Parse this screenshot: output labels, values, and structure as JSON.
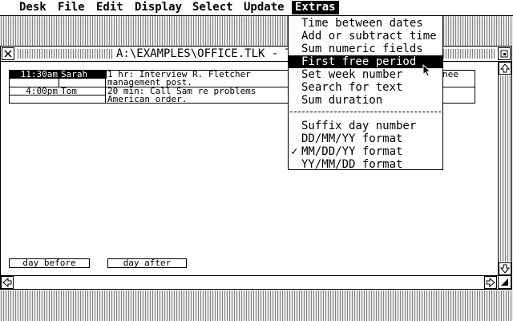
{
  "menubar": {
    "items": [
      {
        "label": "Desk",
        "active": false
      },
      {
        "label": "File",
        "active": false
      },
      {
        "label": "Edit",
        "active": false
      },
      {
        "label": "Display",
        "active": false
      },
      {
        "label": "Select",
        "active": false
      },
      {
        "label": "Update",
        "active": false
      },
      {
        "label": "Extras",
        "active": true
      }
    ]
  },
  "window": {
    "title": "A:\\EXAMPLES\\OFFICE.TLK - Th",
    "close_icon": "close-box-icon",
    "fuller_icon": "fuller-box-icon"
  },
  "appointments": [
    {
      "time": "11:30am",
      "person": "Sarah",
      "text": "1 hr: Interview R. Fletcher",
      "text_tail": "nee",
      "text2": "management post."
    },
    {
      "time": "4:00pm",
      "person": "Tom",
      "text": "20 min: Call Sam re problems",
      "text_tail": "",
      "text2": "American order."
    }
  ],
  "buttons": {
    "day_before": "day before",
    "day_after": "day after"
  },
  "extras_menu": {
    "items": [
      {
        "label": "Time between dates",
        "highlighted": false,
        "checked": false
      },
      {
        "label": "Add or subtract time",
        "highlighted": false,
        "checked": false
      },
      {
        "label": "Sum numeric fields",
        "highlighted": false,
        "checked": false
      },
      {
        "label": "First free period",
        "highlighted": true,
        "checked": false
      },
      {
        "label": "Set week number",
        "highlighted": false,
        "checked": false
      },
      {
        "label": "Search for text",
        "highlighted": false,
        "checked": false
      },
      {
        "label": "Sum duration",
        "highlighted": false,
        "checked": false
      },
      {
        "label": "Suffix day number",
        "highlighted": false,
        "checked": false
      },
      {
        "label": "DD/MM/YY format",
        "highlighted": false,
        "checked": false
      },
      {
        "label": "MM/DD/YY format",
        "highlighted": false,
        "checked": true
      },
      {
        "label": "YY/MM/DD format",
        "highlighted": false,
        "checked": false
      }
    ],
    "check_glyph": "✓"
  },
  "scroll_icons": {
    "up": "up-arrow-icon",
    "down": "down-arrow-icon",
    "left": "left-arrow-icon",
    "right": "right-arrow-icon",
    "size": "size-box-icon"
  }
}
